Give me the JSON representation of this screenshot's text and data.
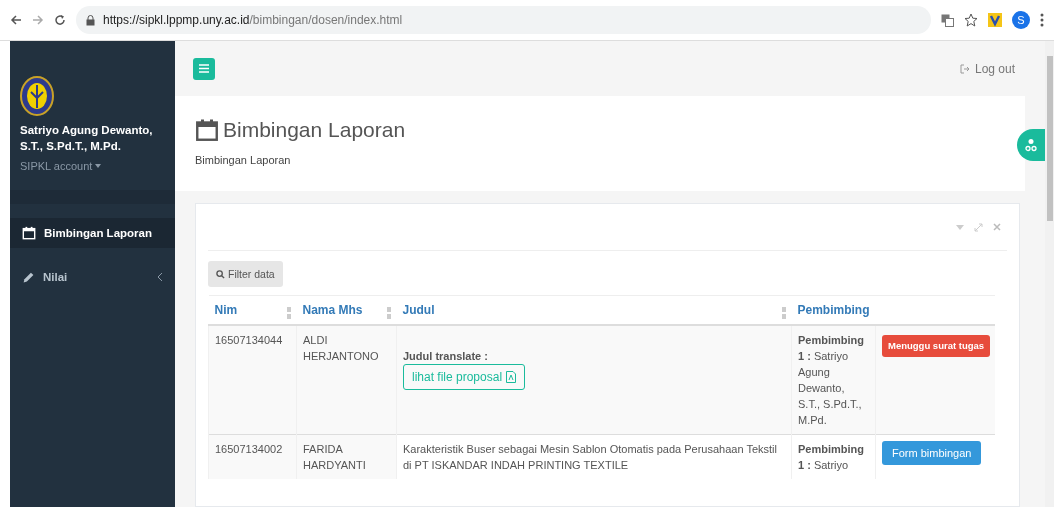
{
  "browser": {
    "url_host": "https://sipkl.lppmp.uny.ac.id",
    "url_path": "/bimbingan/dosen/index.html",
    "profile_initial": "S"
  },
  "sidebar": {
    "user_name": "Satriyo Agung Dewanto, S.T., S.Pd.T., M.Pd.",
    "account": "SIPKL account",
    "items": [
      {
        "label": "Bimbingan Laporan",
        "kind": "calendar",
        "selected": true
      },
      {
        "label": "Nilai",
        "kind": "pencil",
        "selected": false
      }
    ]
  },
  "header": {
    "logout": "Log out"
  },
  "page": {
    "title": "Bimbingan Laporan",
    "breadcrumb": "Bimbingan Laporan"
  },
  "panel": {
    "filter_button": "Filter data",
    "table": {
      "columns": [
        {
          "label": "Nim",
          "sortable": true
        },
        {
          "label": "Nama Mhs",
          "sortable": true
        },
        {
          "label": "Judul",
          "sortable": true
        },
        {
          "label": "Pembimbing",
          "sortable": false
        }
      ],
      "rows": [
        {
          "nim": "16507134044",
          "name": "ALDI HERJANTONO",
          "translate_label": "Judul translate :",
          "proposal_link": "lihat file proposal",
          "pembimbing": "**Pembimbing 1 :** Satriyo Agung Dewanto, S.T., S.Pd.T., M.Pd.",
          "action": {
            "kind": "badge",
            "label": "Menuggu surat tugas"
          }
        },
        {
          "nim": "16507134002",
          "name": "FARIDA HARDYANTI",
          "judul": "Karakteristik Buser sebagai Mesin Sablon Otomatis pada Perusahaan Tekstil di PT ISKANDAR INDAH PRINTING TEXTILE",
          "pembimbing": "**Pembimbing 1 :** Satriyo",
          "action": {
            "kind": "button",
            "label": "Form bimbingan"
          }
        }
      ]
    }
  }
}
